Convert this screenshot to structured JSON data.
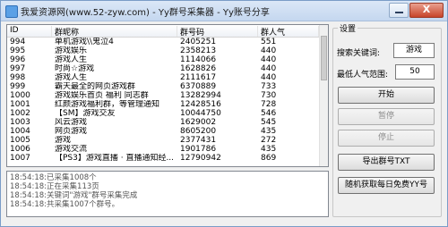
{
  "window": {
    "title": "我爱资源网(www.52-zyw.com) - Yy群号采集器 - Yy账号分享",
    "close_label": "X"
  },
  "list": {
    "columns": [
      "ID",
      "群昵称",
      "群号码",
      "群人气"
    ],
    "rows": [
      [
        "994",
        "单机游戏\\\\鬼泣4",
        "2405251",
        "551"
      ],
      [
        "995",
        "游戏娱乐",
        "2358213",
        "440"
      ],
      [
        "996",
        "游戏人生",
        "1114066",
        "440"
      ],
      [
        "997",
        "时尚☆游戏",
        "1628826",
        "440"
      ],
      [
        "998",
        "游戏人生",
        "2111617",
        "440"
      ],
      [
        "999",
        "霸天最全的网页游戏群",
        "6370889",
        "733"
      ],
      [
        "1000",
        "游戏娱乐首页 福利 同志群",
        "13282994",
        "730"
      ],
      [
        "1001",
        "红颜游戏福利群，等管理通知",
        "12428516",
        "728"
      ],
      [
        "1002",
        "【SM】游戏交友",
        "10044750",
        "546"
      ],
      [
        "1003",
        "风云游戏",
        "1629002",
        "545"
      ],
      [
        "1004",
        "网页游戏",
        "8605200",
        "435"
      ],
      [
        "1005",
        "游戏",
        "2377431",
        "272"
      ],
      [
        "1006",
        "游戏交流",
        "1901786",
        "435"
      ],
      [
        "1007",
        "【PS3】游戏直播 · 直播通知经...",
        "12790942",
        "869"
      ]
    ]
  },
  "log": {
    "lines": [
      "18:54:18:已采集1008个",
      "18:54:18:正在采集113页",
      "18:54:18:关键词\"游戏\"群号采集完成",
      "18:54:18:共采集1007个群号。"
    ]
  },
  "settings": {
    "title": "设置",
    "keyword_label": "搜索关键词:",
    "keyword_value": "游戏",
    "min_pop_label": "最低人气范围:",
    "min_pop_value": "50",
    "start_label": "开始",
    "pause_label": "暂停",
    "stop_label": "停止",
    "export_label": "导出群号TXT",
    "random_label": "随机获取每日免费YY号"
  }
}
